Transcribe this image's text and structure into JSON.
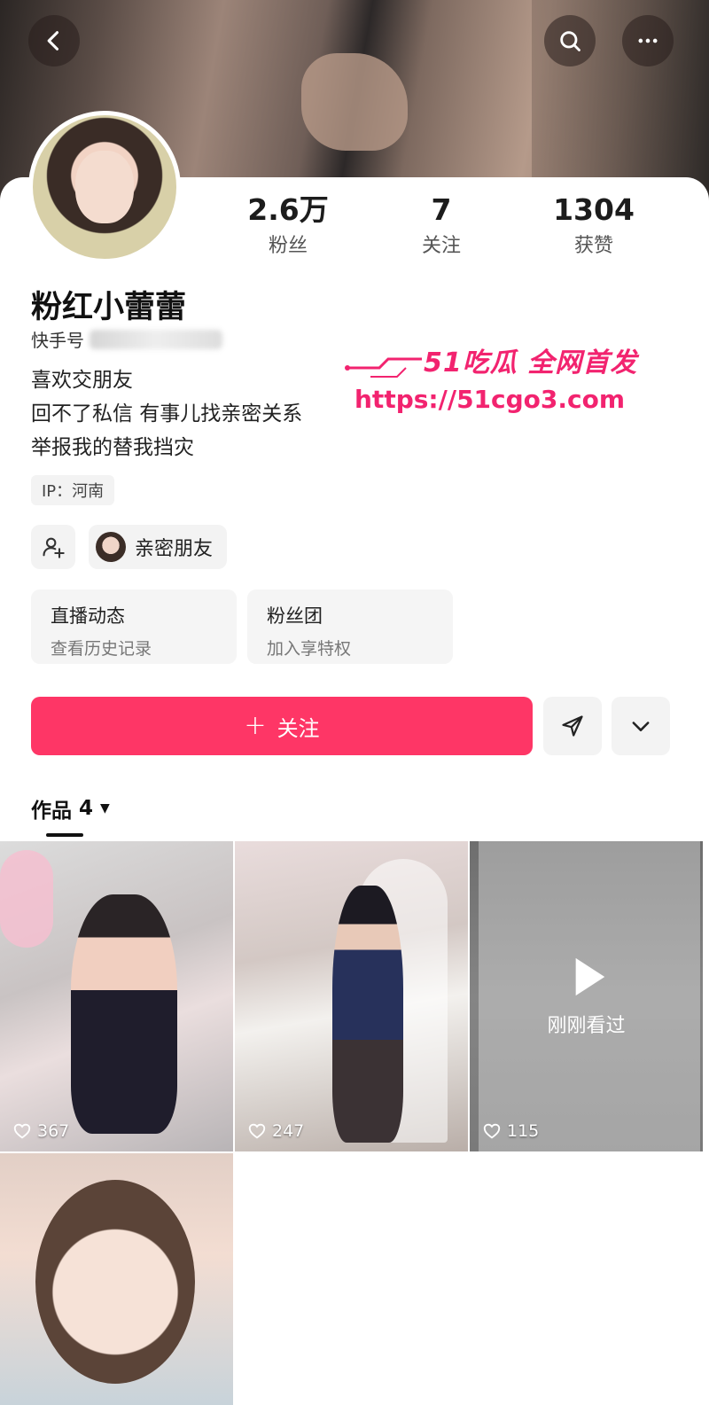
{
  "header": {
    "back_icon": "chevron-left-icon",
    "search_icon": "search-icon",
    "more_icon": "more-dots-icon"
  },
  "profile": {
    "name": "粉红小蕾蕾",
    "uid_label": "快手号",
    "bio": [
      "喜欢交朋友",
      "回不了私信 有事儿找亲密关系",
      "举报我的替我挡灾"
    ],
    "ip": "IP：河南",
    "stats": [
      {
        "value": "2.6万",
        "label": "粉丝"
      },
      {
        "value": "7",
        "label": "关注"
      },
      {
        "value": "1304",
        "label": "获赞"
      }
    ]
  },
  "friends": {
    "close_friend_label": "亲密朋友"
  },
  "cards": [
    {
      "title": "直播动态",
      "subtitle": "查看历史记录"
    },
    {
      "title": "粉丝团",
      "subtitle": "加入享特权"
    }
  ],
  "actions": {
    "follow_label": "关注",
    "follow_plus": "+"
  },
  "works": {
    "tab_label": "作品",
    "count": "4",
    "items": [
      {
        "likes": "367"
      },
      {
        "likes": "247"
      },
      {
        "likes": "115",
        "overlay": "刚刚看过"
      }
    ]
  },
  "watermark": {
    "line1": "51吃瓜 全网首发",
    "line2": "https://51cgo3.com"
  },
  "colors": {
    "accent": "#fe3666",
    "watermark": "#f2236f"
  }
}
